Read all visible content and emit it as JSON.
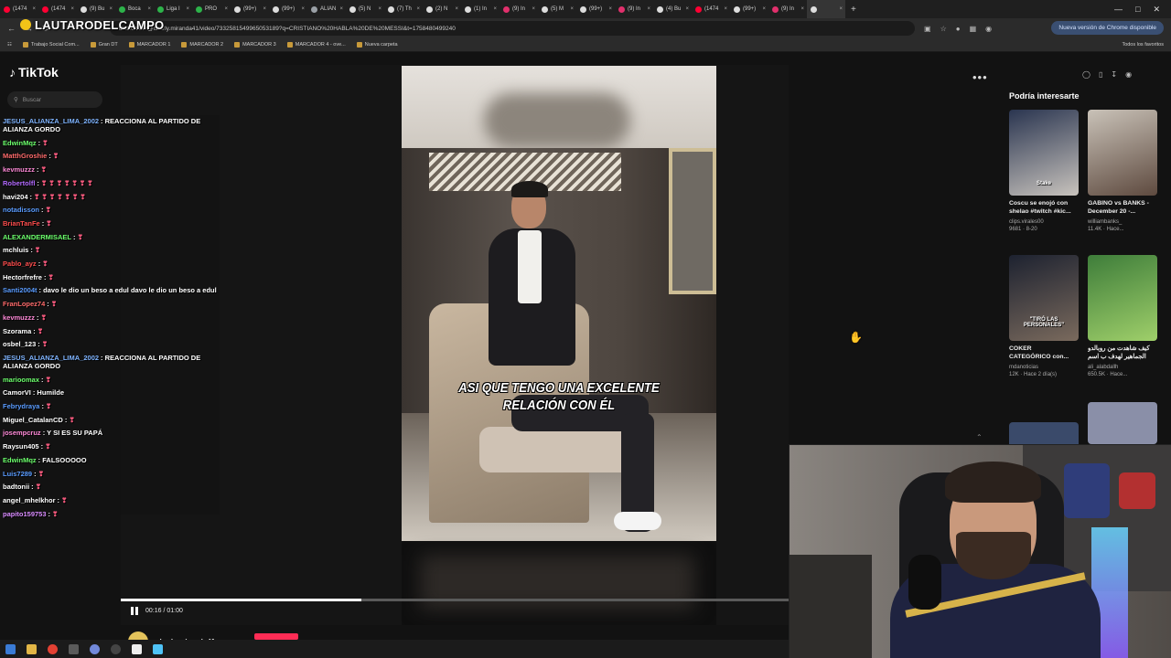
{
  "browser": {
    "tabs": [
      {
        "label": "(1474",
        "color": "#ff0033"
      },
      {
        "label": "(1474",
        "color": "#ff0033"
      },
      {
        "label": "(9) Bu",
        "color": "#dddddd"
      },
      {
        "label": "Boca",
        "color": "#2db34a"
      },
      {
        "label": "Liga I",
        "color": "#2db34a"
      },
      {
        "label": "PRO",
        "color": "#2db34a"
      },
      {
        "label": "(99+)",
        "color": "#dddddd"
      },
      {
        "label": "(99+)",
        "color": "#dddddd"
      },
      {
        "label": "ALIAN",
        "color": "#9aa0a6"
      },
      {
        "label": "(5) N",
        "color": "#dddddd"
      },
      {
        "label": "(7) Th",
        "color": "#dddddd"
      },
      {
        "label": "(2) N",
        "color": "#dddddd"
      },
      {
        "label": "(1) In",
        "color": "#dddddd"
      },
      {
        "label": "(9) In",
        "color": "#e1306c"
      },
      {
        "label": "(5) M",
        "color": "#dddddd"
      },
      {
        "label": "(99+)",
        "color": "#dddddd"
      },
      {
        "label": "(9) In",
        "color": "#e1306c"
      },
      {
        "label": "(4) Bu",
        "color": "#dddddd"
      },
      {
        "label": "(1474",
        "color": "#ff0033"
      },
      {
        "label": "(99+)",
        "color": "#dddddd"
      },
      {
        "label": "(9) In",
        "color": "#e1306c"
      },
      {
        "label": "",
        "color": "#dddddd"
      }
    ],
    "url": "tiktok.com/@charly.miranda41/video/7332581549965053189?q=CRISTIANO%20HABLA%20DE%20MESSI&t=1758480499240",
    "update_button": "Nueva versión de Chrome disponible",
    "bookmarks": [
      "Trabajo Social Com...",
      "Gran DT",
      "MARCADOR 1",
      "MARCADOR 2",
      "MARCADOR 3",
      "MARCADOR 4 - ove...",
      "Nueva carpeta"
    ],
    "all_bookmarks": "Todos los favoritos"
  },
  "watermark": "LAUTARODELCAMPO",
  "tiktok": {
    "logo": "TikTok",
    "search_placeholder": "Buscar",
    "video": {
      "subtitle_line1": "ASI QUE TENGO UNA EXCELENTE",
      "subtitle_line2": "RELACIÓN CON ÉL",
      "time": "00:16 / 01:00",
      "progress": 0.36,
      "author": "charly.miranda41"
    },
    "recommendations_title": "Podría interesarte",
    "recommendations": [
      {
        "caption": "Coscu se enojó con",
        "caption2": "shelao #twitch #kic...",
        "user": "clips.virales00",
        "meta": "9681 · 8-20",
        "badge": "Stake",
        "c1": "#2a3550",
        "c2": "#c8c3bd"
      },
      {
        "caption": "GABINO vs BANKS -",
        "caption2": "December 20 -...",
        "user": "williambanks_",
        "meta": "11.4K · Hace...",
        "badge": "",
        "c1": "#c9c2b8",
        "c2": "#5e4a3f"
      },
      {
        "caption": "COKER",
        "caption2": "CATEGÓRICO con...",
        "user": "mdanoticias",
        "meta": "12K · Hace 2 día(s)",
        "badge": "\"TIRÓ LAS PERSONALES\"",
        "c1": "#1d2230",
        "c2": "#7a6a5d"
      },
      {
        "caption": "كيف شاهدت من روبالدو",
        "caption2": "الجماهير لهدف ب اسم",
        "user": "ali_alabdallh",
        "meta": "650.5K · Hace...",
        "badge": "",
        "c1": "#3e7d3a",
        "c2": "#9fcf6a"
      }
    ]
  },
  "chat": [
    {
      "user": "JESUS_ALIANZA_LIMA_2002",
      "color": "#7fb4ff",
      "text": ": REACCIONA AL PARTIDO DE",
      "text2": "ALIANZA GORDO"
    },
    {
      "user": "EdwinMqz",
      "color": "#6cff6c",
      "text": ":",
      "emotes": 1
    },
    {
      "user": "MatthGroshie",
      "color": "#ff6b6b",
      "text": ":",
      "emotes": 1
    },
    {
      "user": "kevmuzzz",
      "color": "#ff8ad8",
      "text": ":",
      "emotes": 1
    },
    {
      "user": "Robertolfl",
      "color": "#b36bff",
      "text": ":",
      "emotes": 7
    },
    {
      "user": "havi204",
      "color": "#ffffff",
      "text": ":",
      "emotes": 7
    },
    {
      "user": "notadisson",
      "color": "#5a9cff",
      "text": ":",
      "emotes": 1
    },
    {
      "user": "BrianTanFe",
      "color": "#ff4d4d",
      "text": ":",
      "emotes": 1
    },
    {
      "user": "ALEXANDERMISAEL",
      "color": "#6cff6c",
      "text": ":",
      "emotes": 1
    },
    {
      "user": "mchluis",
      "color": "#ffffff",
      "text": ":",
      "emotes": 1
    },
    {
      "user": "Pablo_ayz",
      "color": "#ff4d4d",
      "text": ":",
      "emotes": 1
    },
    {
      "user": "Hectorfrefre",
      "color": "#ffffff",
      "text": ":",
      "emotes": 1
    },
    {
      "user": "Santi2004t",
      "color": "#5a9cff",
      "text": ": davo le dio un beso a edul davo le dio un beso a edul"
    },
    {
      "user": "FranLopez74",
      "color": "#ff6b6b",
      "text": ":",
      "emotes": 1
    },
    {
      "user": "kevmuzzz",
      "color": "#ff8ad8",
      "text": ":",
      "emotes": 1
    },
    {
      "user": "Szorama",
      "color": "#ffffff",
      "text": ":",
      "emotes": 1
    },
    {
      "user": "osbel_123",
      "color": "#ffffff",
      "text": ":",
      "emotes": 1
    },
    {
      "user": "JESUS_ALIANZA_LIMA_2002",
      "color": "#7fb4ff",
      "text": ": REACCIONA AL PARTIDO DE",
      "text2": "ALIANZA GORDO"
    },
    {
      "user": "marioomax",
      "color": "#6cff6c",
      "text": ":",
      "emotes": 1
    },
    {
      "user": "CamorVI",
      "color": "#ffffff",
      "text": ": Humilde"
    },
    {
      "user": "Febrydraya",
      "color": "#5a9cff",
      "text": ":",
      "emotes": 1
    },
    {
      "user": "Miguel_CatalanCD",
      "color": "#ffffff",
      "text": ":",
      "emotes": 1
    },
    {
      "user": "josempcruz",
      "color": "#ff8ad8",
      "text": ": Y SI ES SU PAPÁ"
    },
    {
      "user": "Raysun405",
      "color": "#ffffff",
      "text": ":",
      "emotes": 1
    },
    {
      "user": "EdwinMqz",
      "color": "#6cff6c",
      "text": ": FALSOOOOO"
    },
    {
      "user": "Luis7289",
      "color": "#5a9cff",
      "text": ":",
      "emotes": 1
    },
    {
      "user": "badtonii",
      "color": "#ffffff",
      "text": ":",
      "emotes": 1
    },
    {
      "user": "angel_mhelkhor",
      "color": "#ffffff",
      "text": ":",
      "emotes": 1
    },
    {
      "user": "papito159753",
      "color": "#d98cff",
      "text": ":",
      "emotes": 1
    }
  ],
  "colors": {
    "tiktok_red": "#fe2c55",
    "background": "#121212",
    "chrome_dark": "#1f1f1f"
  }
}
